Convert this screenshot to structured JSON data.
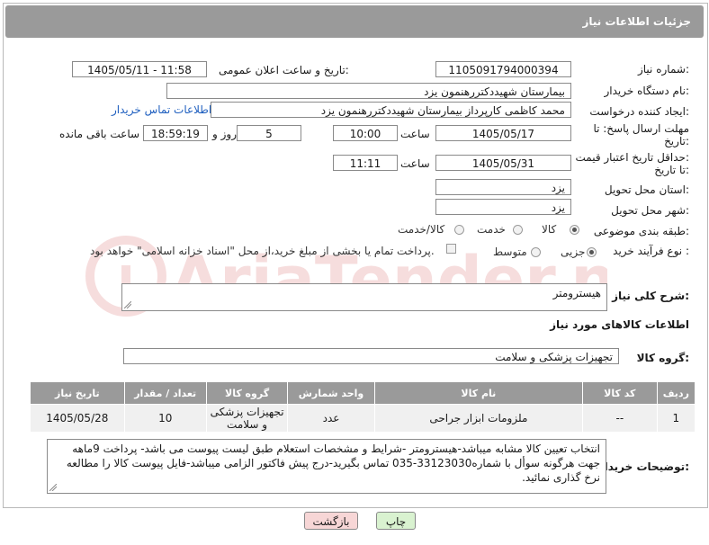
{
  "header": {
    "title": "جزئیات اطلاعات نیاز"
  },
  "fields": {
    "need_number_label": "شماره نیاز:",
    "need_number": "1105091794000394",
    "announce_label": "تاریخ و ساعت اعلان عمومی:",
    "announce_value": "1405/05/11 - 11:58",
    "buyer_org_label": "نام دستگاه خریدار:",
    "buyer_org": "بیمارستان شهیددکتررهنمون یزد",
    "creator_label": "ایجاد کننده درخواست:",
    "creator": "محمد کاظمی کارپرداز بیمارستان شهیددکتررهنمون یزد",
    "buyer_contact_link": "اطلاعات تماس خریدار",
    "deadline_label_1": "مهلت ارسال پاسخ: تا",
    "deadline_label_2": "تاریخ:",
    "deadline_date": "1405/05/17",
    "time_label": "ساعت",
    "deadline_time": "10:00",
    "days_value": "5",
    "days_label": "روز و",
    "remaining_time": "18:59:19",
    "remaining_label": "ساعت باقی مانده",
    "validity_label_1": "حداقل تاریخ اعتبار قیمت:",
    "validity_label_2": "تا تاریخ:",
    "validity_date": "1405/05/31",
    "validity_time": "11:11",
    "province_label": "استان محل تحویل:",
    "province": "یزد",
    "city_label": "شهر محل تحویل:",
    "city": "یزد",
    "category_label": "طبقه بندی موضوعی:",
    "category_options": [
      "کالا",
      "خدمت",
      "کالا/خدمت"
    ],
    "category_selected": "کالا",
    "process_label": "نوع فرآیند خرید :",
    "process_options": [
      "جزیی",
      "متوسط"
    ],
    "process_selected": "جزیی",
    "payment_note": "پرداخت تمام یا بخشی از مبلغ خرید،از محل \"اسناد خزانه اسلامی\" خواهد بود.",
    "general_desc_label": "شرح کلی نیاز:",
    "general_desc": "هیسترومتر",
    "goods_info_title": "اطلاعات کالاهای مورد نیاز",
    "goods_group_label": "گروه کالا:",
    "goods_group": "تجهیزات پزشکی و سلامت",
    "buyer_desc_label": "توضیحات خریدار:",
    "buyer_desc": "انتخاب تعیین کالا مشابه میباشد-هیسترومتر -شرایط و مشخصات استعلام طبق لیست پیوست می باشد- پرداخت 9ماهه جهت هرگونه سوأل با شماره33123030-035 تماس بگیرید-درج پیش فاکتور الزامی میباشد-فایل پیوست کالا را مطالعه نرخ گذاری نمائید."
  },
  "table": {
    "headers": [
      "ردیف",
      "کد کالا",
      "نام کالا",
      "واحد شمارش",
      "گروه کالا",
      "تعداد / مقدار",
      "تاریخ نیاز"
    ],
    "rows": [
      [
        "1",
        "--",
        "ملزومات ابزار جراحی",
        "عدد",
        "تجهیزات پزشکی و سلامت",
        "10",
        "1405/05/28"
      ]
    ]
  },
  "buttons": {
    "print": "چاپ",
    "back": "بازگشت"
  },
  "watermark": "AriaTender.neT",
  "colors": {
    "header_bg": "#9a9a9a",
    "link": "#1f5fbf",
    "back_button": "#f7d6d6",
    "print_button": "#d9f2d0"
  }
}
